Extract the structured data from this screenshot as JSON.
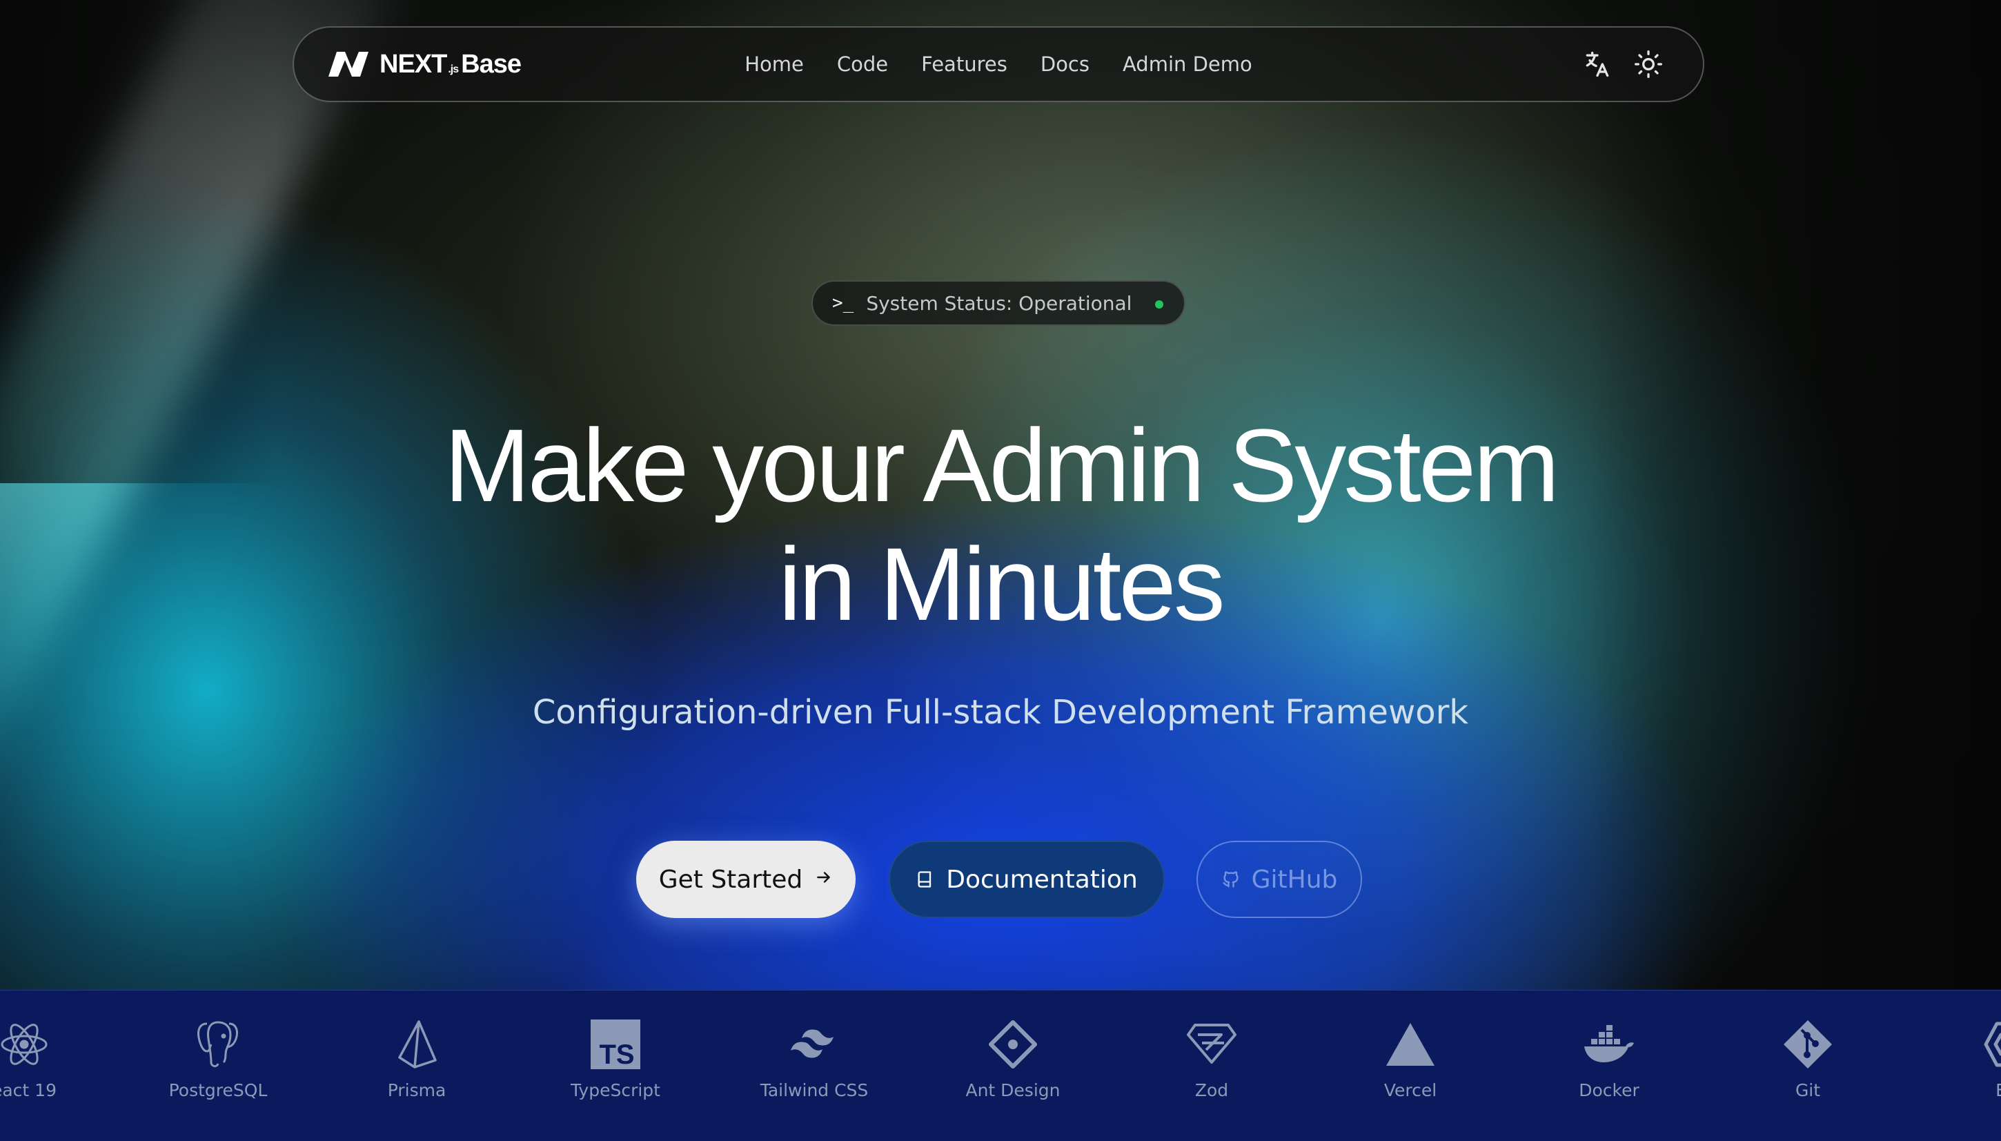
{
  "nav": {
    "brand": {
      "main": "NEXT",
      "js": ".js",
      "suffix": "Base"
    },
    "links": [
      "Home",
      "Code",
      "Features",
      "Docs",
      "Admin Demo"
    ]
  },
  "hero": {
    "status": "System Status: Operational",
    "status_prompt": ">_",
    "headline_line1": "Make your Admin System",
    "headline_line2": "in Minutes",
    "subtitle": "Configuration-driven Full-stack Development Framework",
    "buttons": {
      "get_started": "Get Started",
      "documentation": "Documentation",
      "github": "GitHub"
    }
  },
  "tech_stack": [
    {
      "name": "eact 19",
      "icon": "react-icon"
    },
    {
      "name": "PostgreSQL",
      "icon": "postgresql-icon"
    },
    {
      "name": "Prisma",
      "icon": "prisma-icon"
    },
    {
      "name": "TypeScript",
      "icon": "typescript-icon"
    },
    {
      "name": "Tailwind CSS",
      "icon": "tailwind-icon"
    },
    {
      "name": "Ant Design",
      "icon": "antdesign-icon"
    },
    {
      "name": "Zod",
      "icon": "zod-icon"
    },
    {
      "name": "Vercel",
      "icon": "vercel-icon"
    },
    {
      "name": "Docker",
      "icon": "docker-icon"
    },
    {
      "name": "Git",
      "icon": "git-icon"
    },
    {
      "name": "ES",
      "icon": "eslint-icon"
    }
  ],
  "colors": {
    "status_dot": "#22c55e",
    "doc_button": "#0f3a7a",
    "tech_strip": "#0a1a5c"
  }
}
